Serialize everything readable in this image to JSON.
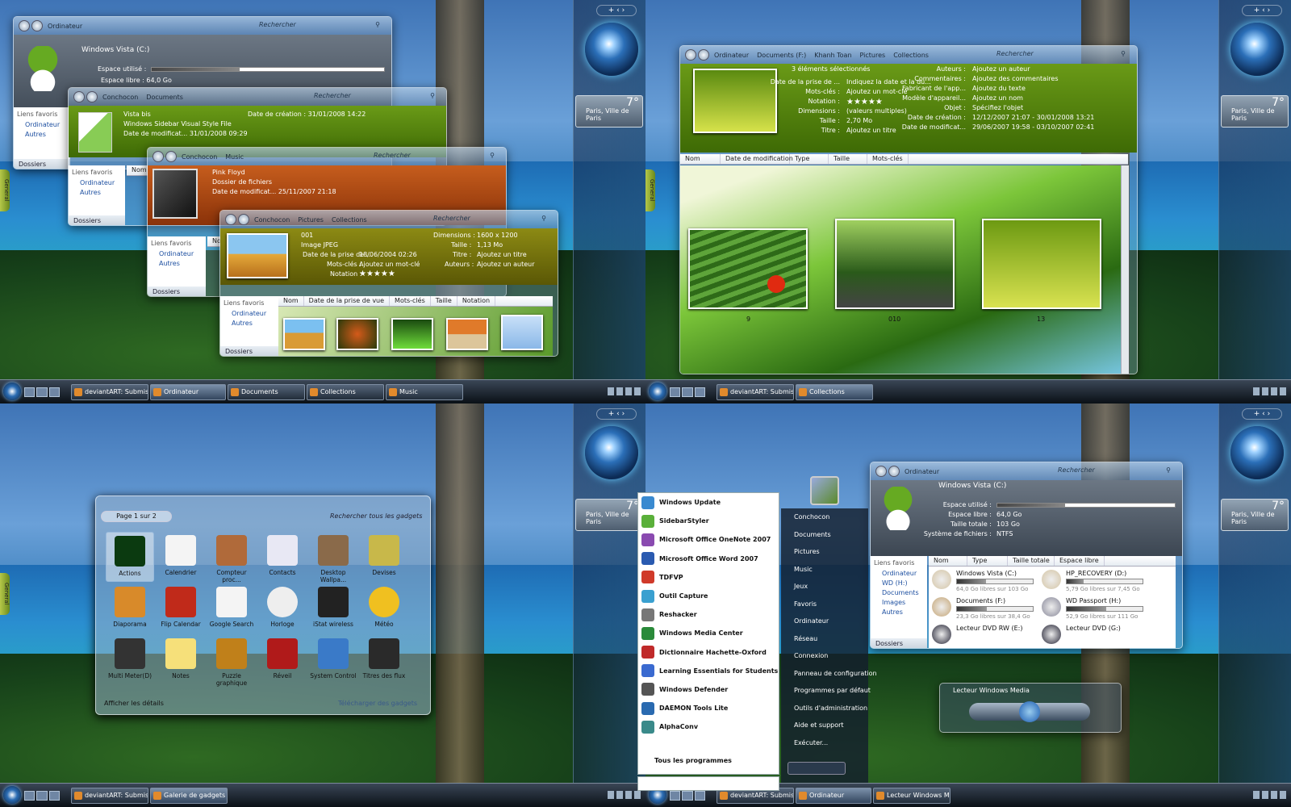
{
  "desktop": {
    "sidebar_controls": "+ ‹ ›",
    "weather": {
      "temp": "7°",
      "city": "Paris, Ville de Paris"
    },
    "gadget_tab": "General"
  },
  "q1": {
    "taskbar": [
      "deviantART: Submissi...",
      "Ordinateur",
      "Documents",
      "Collections",
      "Music"
    ],
    "w1": {
      "path": [
        "Ordinateur"
      ],
      "search": "Rechercher",
      "drive": "Windows Vista (C:)",
      "used_label": "Espace utilisé :",
      "free": "Espace libre : 64,0 Go",
      "fav": "Liens favoris",
      "items": [
        "Ordinateur",
        "Autres"
      ],
      "folders": "Dossiers",
      "used": 0.38
    },
    "w2": {
      "path": [
        "Conchocon",
        "Documents"
      ],
      "search": "Rechercher",
      "name": "Vista bis",
      "type": "Windows Sidebar Visual Style File",
      "created": "Date de création : 31/01/2008 14:22",
      "modified": "Date de modificat... 31/01/2008 09:29",
      "fav": "Liens favoris",
      "items": [
        "Ordinateur",
        "Autres"
      ],
      "folders": "Dossiers",
      "col": "Nom"
    },
    "w3": {
      "path": [
        "Conchocon",
        "Music"
      ],
      "search": "Rechercher",
      "name": "Pink Floyd",
      "type": "Dossier de fichiers",
      "modified": "Date de modificat... 25/11/2007 21:18",
      "fav": "Liens favoris",
      "items": [
        "Ordinateur",
        "Autres"
      ],
      "folders": "Dossiers",
      "col": "Nom"
    },
    "w4": {
      "path": [
        "Conchocon",
        "Pictures",
        "Collections"
      ],
      "search": "Rechercher",
      "name": "001",
      "type": "Image JPEG",
      "taken_label": "Date de la prise de ...",
      "taken": "18/06/2004 02:26",
      "kw_label": "Mots-clés :",
      "kw": "Ajoutez un mot-clé",
      "rating_label": "Notation :",
      "stars": "★★★★★",
      "dim_label": "Dimensions :",
      "dim": "1600 x 1200",
      "size_label": "Taille :",
      "size": "1,13 Mo",
      "title_label": "Titre :",
      "title": "Ajoutez un titre",
      "author_label": "Auteurs :",
      "author": "Ajoutez un auteur",
      "cols": [
        "Nom",
        "Date de la prise de vue",
        "Mots-clés",
        "Taille",
        "Notation"
      ],
      "fav": "Liens favoris",
      "items": [
        "Ordinateur",
        "Autres"
      ],
      "folders": "Dossiers"
    }
  },
  "q2": {
    "taskbar": [
      "deviantART: Submissi...",
      "Collections"
    ],
    "win": {
      "path": [
        "Ordinateur",
        "Documents (F:)",
        "Khanh Toan",
        "Pictures",
        "Collections"
      ],
      "search": "Rechercher",
      "selected": "3 éléments sélectionnés",
      "left": [
        [
          "Date de la prise de ...",
          "Indiquez la date et la du..."
        ],
        [
          "Mots-clés :",
          "Ajoutez un mot-clé"
        ],
        [
          "Notation :",
          "★★★★★"
        ],
        [
          "Dimensions :",
          "(valeurs multiples)"
        ],
        [
          "Taille :",
          "2,70 Mo"
        ],
        [
          "Titre :",
          "Ajoutez un titre"
        ]
      ],
      "right": [
        [
          "Auteurs :",
          "Ajoutez un auteur"
        ],
        [
          "Commentaires :",
          "Ajoutez des commentaires"
        ],
        [
          "Fabricant de l'app...",
          "Ajoutez du texte"
        ],
        [
          "Modèle d'appareil...",
          "Ajoutez un nom"
        ],
        [
          "Objet :",
          "Spécifiez l'objet"
        ],
        [
          "Date de création :",
          "12/12/2007 21:07 - 30/01/2008 13:21"
        ],
        [
          "Date de modificat...",
          "29/06/2007 19:58 - 03/10/2007 02:41"
        ]
      ],
      "cols": [
        "Nom",
        "Date de modification",
        "Type",
        "Taille",
        "Mots-clés"
      ],
      "thumbs": [
        "9",
        "010",
        "13"
      ]
    }
  },
  "q3": {
    "taskbar": [
      "deviantART: Submissi...",
      "Galerie de gadgets"
    ],
    "gallery": {
      "page": "Page 1 sur 2",
      "search": "Rechercher tous les gadgets",
      "details": "Afficher les détails",
      "online": "Télécharger des gadgets",
      "items": [
        "Actions",
        "Calendrier",
        "Compteur proc...",
        "Contacts",
        "Desktop Wallpa...",
        "Devises",
        "Diaporama",
        "Flip Calendar",
        "Google Search",
        "Horloge",
        "iStat wireless",
        "Météo",
        "Multi Meter(D)",
        "Notes",
        "Puzzle graphique",
        "Réveil",
        "System Control",
        "Titres des flux"
      ]
    }
  },
  "q4": {
    "taskbar": [
      "deviantART: Submissi...",
      "Ordinateur",
      "Lecteur Windows M..."
    ],
    "start": {
      "left": [
        "Windows Update",
        "SidebarStyler",
        "Microsoft Office OneNote 2007",
        "Microsoft Office Word 2007",
        "TDFVP",
        "Outil Capture",
        "Reshacker",
        "Windows Media Center",
        "Dictionnaire Hachette-Oxford",
        "Learning Essentials for Students",
        "Windows Defender",
        "DAEMON Tools Lite",
        "AlphaConv"
      ],
      "all": "Tous les programmes",
      "right": [
        "Conchocon",
        "Documents",
        "Pictures",
        "Music",
        "Jeux",
        "Favoris",
        "Ordinateur",
        "Réseau",
        "Connexion",
        "Panneau de configuration",
        "Programmes par défaut",
        "Outils d'administration",
        "Aide et support",
        "Exécuter..."
      ]
    },
    "explorer": {
      "path": [
        "Ordinateur"
      ],
      "search": "Rechercher",
      "drive": "Windows Vista (C:)",
      "rows": [
        [
          "Espace utilisé :",
          ""
        ],
        [
          "Espace libre :",
          "64,0 Go"
        ],
        [
          "Taille totale :",
          "103 Go"
        ],
        [
          "Système de fichiers :",
          "NTFS"
        ]
      ],
      "fav": "Liens favoris",
      "items": [
        "Ordinateur",
        "WD (H:)",
        "Documents",
        "Images",
        "Autres"
      ],
      "folders": "Dossiers",
      "cols": [
        "Nom",
        "Type",
        "Taille totale",
        "Espace libre"
      ],
      "drives": [
        {
          "name": "Windows Vista (C:)",
          "info": "64,0 Go libres sur 103 Go",
          "fill": 0.38
        },
        {
          "name": "HP_RECOVERY (D:)",
          "info": "5,79 Go libres sur 7,45 Go",
          "fill": 0.22
        },
        {
          "name": "Documents (F:)",
          "info": "23,3 Go libres sur 38,4 Go",
          "fill": 0.39
        },
        {
          "name": "WD Passport (H:)",
          "info": "52,9 Go libres sur 111 Go",
          "fill": 0.52
        },
        {
          "name": "Lecteur DVD RW (E:)",
          "info": ""
        },
        {
          "name": "Lecteur DVD (G:)",
          "info": ""
        }
      ]
    },
    "player": {
      "title": "Lecteur Windows Media"
    }
  }
}
